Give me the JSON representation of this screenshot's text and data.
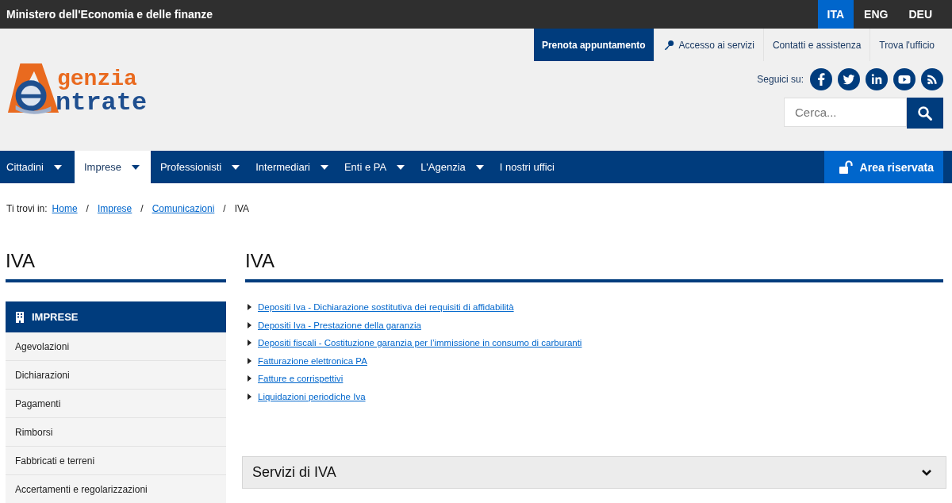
{
  "top_bar": {
    "title": "Ministero dell'Economia e delle finanze",
    "languages": [
      {
        "label": "ITA",
        "selected": true
      },
      {
        "label": "ENG",
        "selected": false
      },
      {
        "label": "DEU",
        "selected": false
      }
    ]
  },
  "header": {
    "logo": {
      "line_1": "genzia",
      "line_2": "ntrate"
    },
    "utility_links": [
      {
        "label": "Prenota appuntamento",
        "kind": "primary"
      },
      {
        "label": "Accesso ai servizi",
        "kind": "key"
      },
      {
        "label": "Contatti e assistenza",
        "kind": "plain"
      },
      {
        "label": "Trova l'ufficio",
        "kind": "plain"
      }
    ],
    "social": {
      "label": "Seguici su:",
      "icons": [
        {
          "kind": "facebook"
        },
        {
          "kind": "twitter"
        },
        {
          "kind": "linkedin"
        },
        {
          "kind": "youtube"
        },
        {
          "kind": "rss"
        }
      ]
    },
    "search": {
      "placeholder": "Cerca..."
    }
  },
  "nav": {
    "items": [
      {
        "label": "Cittadini",
        "selected": false,
        "dropdown": true
      },
      {
        "label": "Imprese",
        "selected": true,
        "dropdown": true
      },
      {
        "label": "Professionisti",
        "selected": false,
        "dropdown": true
      },
      {
        "label": "Intermediari",
        "selected": false,
        "dropdown": true
      },
      {
        "label": "Enti e PA",
        "selected": false,
        "dropdown": true
      },
      {
        "label": "L'Agenzia",
        "selected": false,
        "dropdown": true
      },
      {
        "label": "I nostri uffici",
        "selected": false,
        "dropdown": false
      }
    ],
    "reserved": "Area riservata"
  },
  "breadcrumb": {
    "label": "Ti trovi in:",
    "separator": "/",
    "items": [
      {
        "label": "Home",
        "link": true
      },
      {
        "label": "Imprese",
        "link": true
      },
      {
        "label": "Comunicazioni",
        "link": true
      },
      {
        "label": "IVA",
        "link": false
      }
    ]
  },
  "sidebar": {
    "title": "IVA",
    "section": "IMPRESE",
    "items": [
      "Agevolazioni",
      "Dichiarazioni",
      "Pagamenti",
      "Rimborsi",
      "Fabbricati e terreni",
      "Accertamenti e regolarizzazioni"
    ]
  },
  "main": {
    "title": "IVA",
    "links": [
      "Depositi Iva - Dichiarazione sostitutiva dei requisiti di affidabilità",
      "Depositi Iva - Prestazione della garanzia",
      "Depositi fiscali - Costituzione garanzia per l’immissione in consumo di carburanti",
      "Fatturazione elettronica PA",
      "Fatture e corrispettivi",
      "Liquidazioni periodiche Iva"
    ],
    "accordion": {
      "title": "Servizi di IVA",
      "expanded": false
    }
  }
}
